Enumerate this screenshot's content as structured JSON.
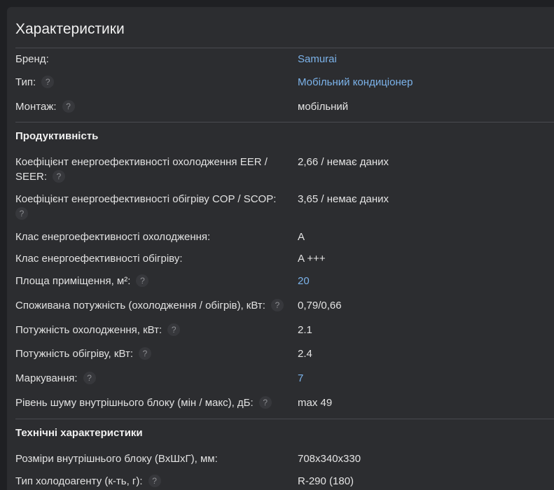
{
  "title": "Характеристики",
  "help_glyph": "?",
  "rows": [
    {
      "label": "Бренд:",
      "value": "Samurai"
    },
    {
      "label": "Тип:",
      "value": "Мобільний кондиціонер"
    },
    {
      "label": "Монтаж:",
      "value": "мобільний"
    }
  ],
  "sections": [
    {
      "title": "Продуктивність",
      "rows": [
        {
          "label": "Коефіцієнт енергоефективності охолодження EER / SEER:",
          "value": "2,66 / немає даних"
        },
        {
          "label": "Коефіцієнт енергоефективності обігріву COP / SCOP:",
          "value": "3,65 / немає даних"
        },
        {
          "label": "Клас енергоефективності охолодження:",
          "value": "A"
        },
        {
          "label": "Клас енергоефективності обігріву:",
          "value": "A +++"
        },
        {
          "label": "Площа приміщення, м²:",
          "value": "20"
        },
        {
          "label": "Споживана потужність (охолодження / обігрів), кВт:",
          "value": "0,79/0,66"
        },
        {
          "label": "Потужність охолодження, кВт:",
          "value": "2.1"
        },
        {
          "label": "Потужність обігріву, кВт:",
          "value": "2.4"
        },
        {
          "label": "Маркування:",
          "value": "7"
        },
        {
          "label": "Рівень шуму внутрішнього блоку (мін / макс), дБ:",
          "value": "max 49"
        }
      ]
    },
    {
      "title": "Технічні характеристики",
      "rows": [
        {
          "label": "Розміри внутрішнього блоку (ВхШхГ), мм:",
          "value": "708x340x330"
        },
        {
          "label": "Тип холодоагенту (к-ть, г):",
          "value": "R-290 (180)"
        }
      ]
    }
  ]
}
